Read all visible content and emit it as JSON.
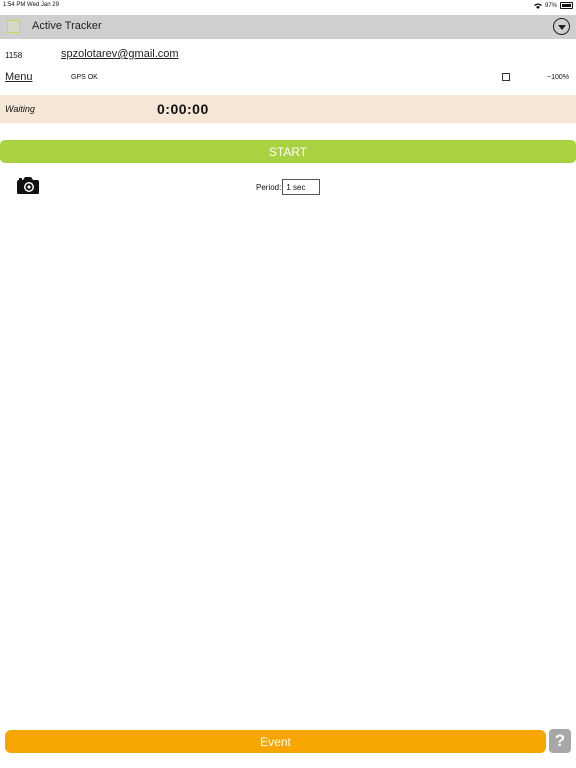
{
  "status_bar": {
    "time_date": "1:54 PM  Wed Jan 29",
    "battery": "97%"
  },
  "header": {
    "title": "Active Tracker",
    "dropdown_icon": "chevron-down-circle-icon"
  },
  "account": {
    "id": "1158",
    "email": "spzolotarev@gmail.com"
  },
  "status_row": {
    "menu_label": "Menu",
    "gps_status": "GPS OK",
    "battery_percent": "~100%"
  },
  "tracker": {
    "state": "Waiting",
    "timer": "0:00:00"
  },
  "controls": {
    "start_label": "START",
    "period_label": "Period:",
    "period_value": "1 sec",
    "camera_icon": "camera-icon"
  },
  "footer": {
    "event_label": "Event",
    "help_label": "?"
  },
  "colors": {
    "start_green": "#a8d240",
    "event_orange": "#f7a500",
    "title_bar_gray": "#cfcfcf",
    "state_bar_beige": "#f6e6d6",
    "help_gray": "#a7a7a7"
  }
}
